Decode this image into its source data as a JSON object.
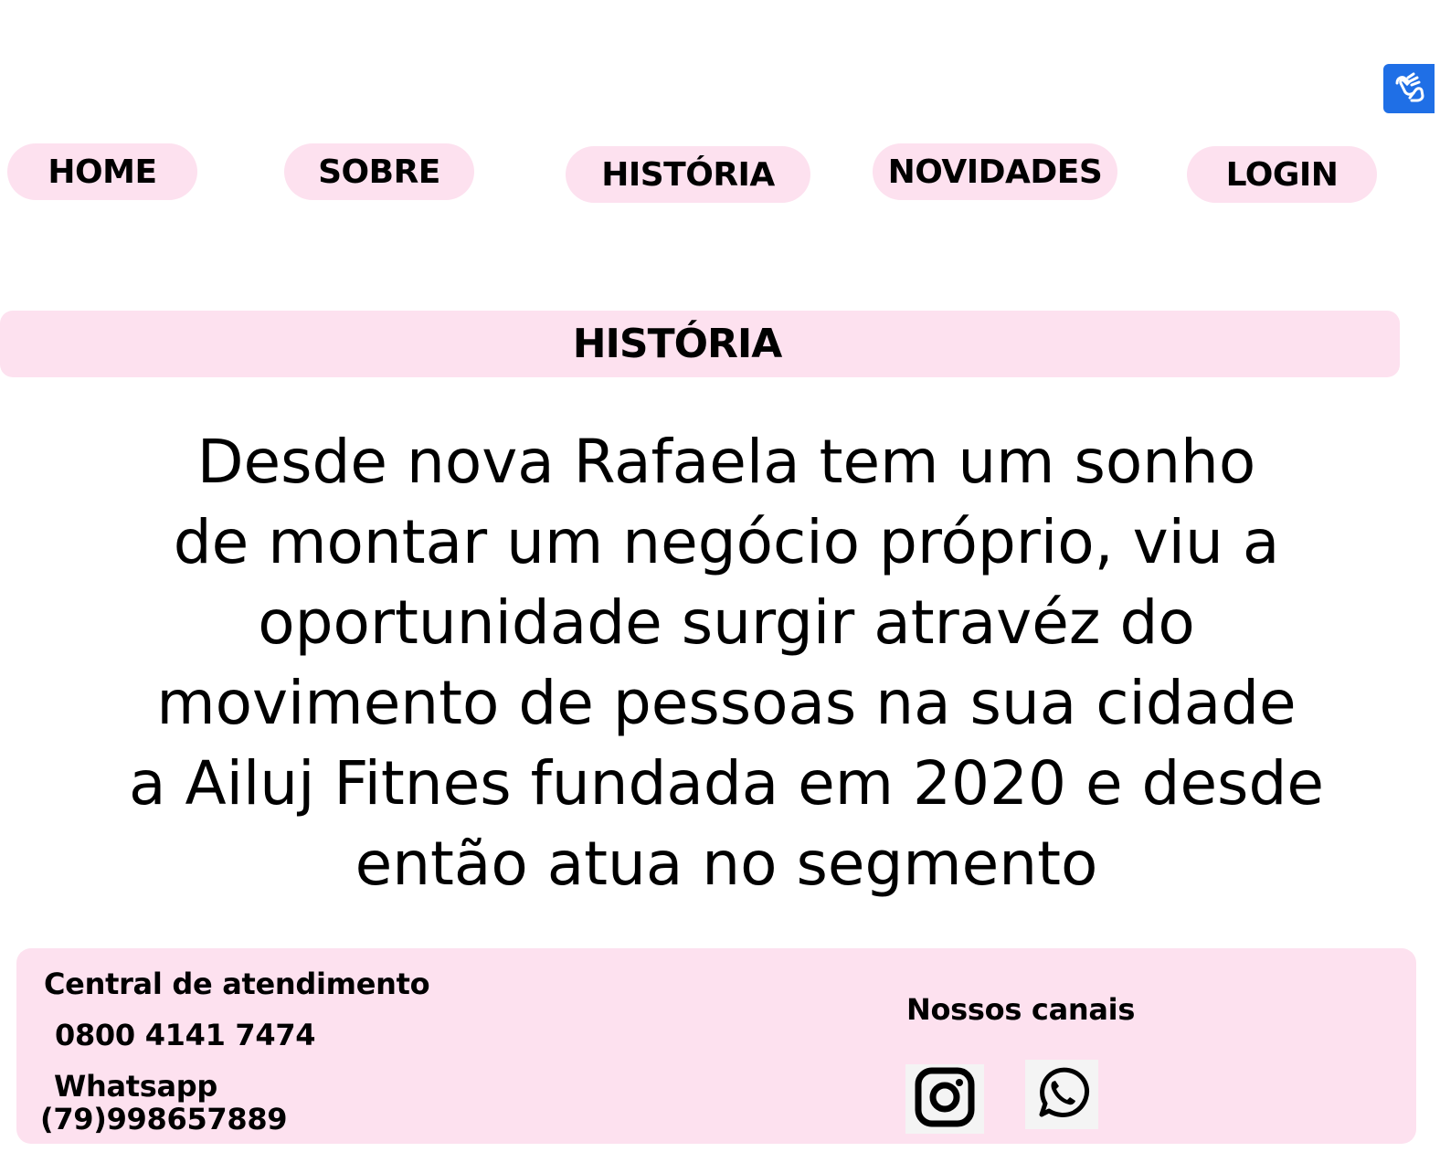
{
  "accessibility": {
    "icon": "sign-language-hands-icon",
    "color": "#1f6fe6"
  },
  "nav": {
    "home": "HOME",
    "sobre": "SOBRE",
    "historia": "HISTÓRIA",
    "novidades": "NOVIDADES",
    "login": "LOGIN"
  },
  "section": {
    "title": "HISTÓRIA"
  },
  "story": {
    "lines": [
      "Desde nova Rafaela tem um sonho",
      "de montar um negócio próprio, viu a",
      "oportunidade surgir atravéz do",
      "movimento de pessoas na sua cidade",
      "a Ailuj Fitnes fundada em 2020 e desde",
      "então atua no segmento"
    ]
  },
  "footer": {
    "central_label": "Central de atendimento",
    "central_phone": "0800 4141 7474",
    "whatsapp_label": "Whatsapp",
    "whatsapp_number": "(79)998657889",
    "channels_label": "Nossos canais",
    "channels": [
      "instagram-icon",
      "whatsapp-icon"
    ]
  },
  "colors": {
    "pill_background": "#fde1ef",
    "text": "#000000"
  }
}
